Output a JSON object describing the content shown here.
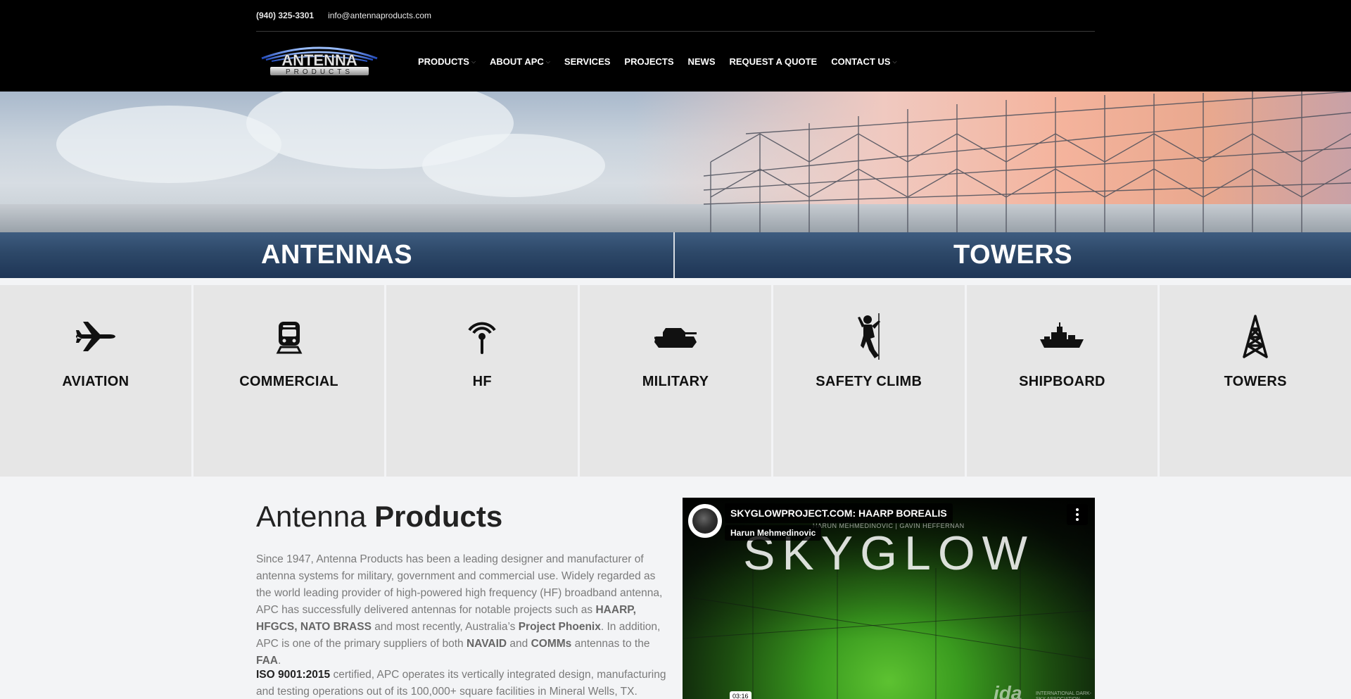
{
  "topbar": {
    "phone": "(940) 325-3301",
    "email": "info@antennaproducts.com"
  },
  "logo": {
    "line1": "ANTENNA",
    "line2": "PRODUCTS"
  },
  "nav": {
    "items": [
      {
        "label": "PRODUCTS",
        "has_dropdown": true
      },
      {
        "label": "ABOUT APC",
        "has_dropdown": true
      },
      {
        "label": "SERVICES",
        "has_dropdown": false
      },
      {
        "label": "PROJECTS",
        "has_dropdown": false
      },
      {
        "label": "NEWS",
        "has_dropdown": false
      },
      {
        "label": "REQUEST A QUOTE",
        "has_dropdown": false
      },
      {
        "label": "CONTACT US",
        "has_dropdown": true
      }
    ],
    "caret": "⌵"
  },
  "categories": {
    "left": "ANTENNAS",
    "right": "TOWERS"
  },
  "tiles": [
    {
      "label": "AVIATION",
      "icon": "airplane-icon"
    },
    {
      "label": "COMMERCIAL",
      "icon": "train-icon"
    },
    {
      "label": "HF",
      "icon": "broadcast-icon"
    },
    {
      "label": "MILITARY",
      "icon": "tank-icon"
    },
    {
      "label": "SAFETY CLIMB",
      "icon": "climber-icon"
    },
    {
      "label": "SHIPBOARD",
      "icon": "ship-icon"
    },
    {
      "label": "TOWERS",
      "icon": "tower-icon"
    }
  ],
  "main": {
    "heading_light": "Antenna",
    "heading_bold": "Products",
    "para1": {
      "t1": "Since 1947, Antenna Products has been a leading designer and manufacturer of antenna systems for military, government and commercial use.  Widely regarded as the world leading provider of high-powered high frequency (HF) broadband antenna, APC has successfully delivered antennas for notable projects such as ",
      "b1": "HAARP, HFGCS, NATO BRASS",
      "t2": " and most recently, Australia’s ",
      "b2": "Project Phoenix",
      "t3": ".  In addition, APC is one of the primary suppliers of both ",
      "b3": "NAVAID",
      "t4": " and ",
      "b4": "COMMs",
      "t5": " antennas to the ",
      "b5": "FAA",
      "t6": "."
    },
    "para2": {
      "b1": "ISO 9001:2015",
      "t1": " certified, APC operates its vertically integrated design, manufacturing and testing operations out of its 100,000+ square facilities in Mineral Wells, TX."
    }
  },
  "video": {
    "title": "SKYGLOWPROJECT.COM: HAARP BOREALIS",
    "channel": "Harun Mehmedinovic",
    "overlay_title": "SKYGLOW",
    "overlay_credits": "HARUN MEHMEDINOVIC | GAVIN HEFFERNAN",
    "timestamp": "03:16",
    "watermark": "ida",
    "watermark_sub": "INTERNATIONAL DARK-SKY ASSOCIATION"
  },
  "colors": {
    "header_bg": "#000000",
    "category_bar": "#2d4868",
    "tile_bg": "#e6e6e6",
    "page_bg": "#f3f4f6"
  }
}
